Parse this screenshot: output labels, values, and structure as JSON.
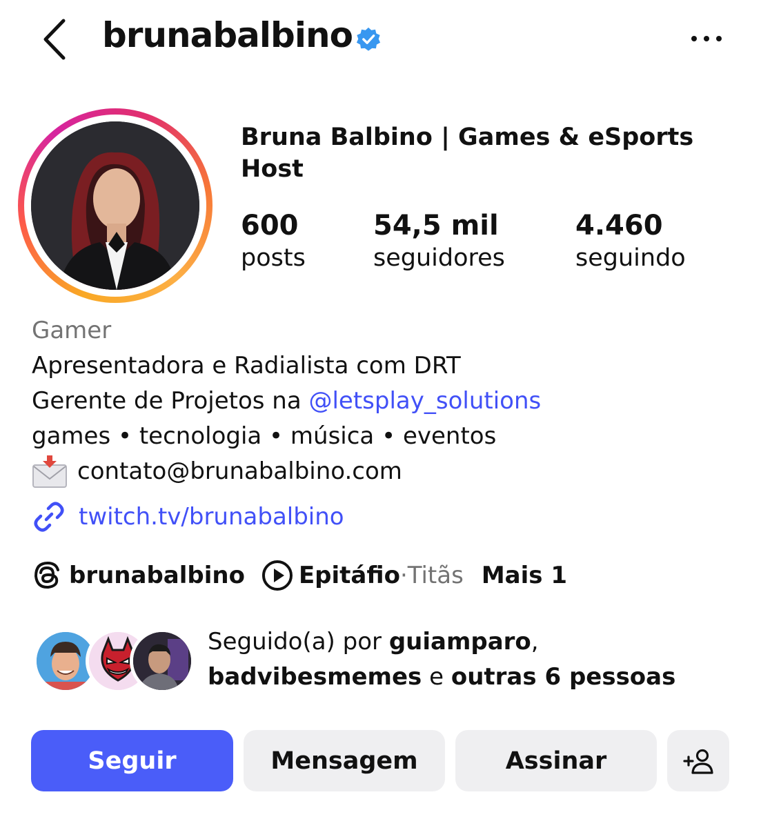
{
  "header": {
    "username": "brunabalbino",
    "back_icon": "chevron-left-icon",
    "verified_icon": "verified-badge-icon",
    "more_icon": "ellipsis-icon"
  },
  "profile": {
    "full_name": "Bruna Balbino | Games & eSports Host",
    "stats": [
      {
        "value": "600",
        "label": "posts"
      },
      {
        "value": "54,5 mil",
        "label": "seguidores"
      },
      {
        "value": "4.460",
        "label": "seguindo"
      }
    ]
  },
  "bio": {
    "category": "Gamer",
    "line1": "Apresentadora e Radialista com DRT",
    "line2_prefix": "Gerente de Projetos na ",
    "line2_mention": "@letsplay_solutions",
    "line3": "games • tecnologia • música • eventos",
    "email_icon": "envelope-icon",
    "email": "contato@brunabalbino.com",
    "link_icon": "link-icon",
    "link": "twitch.tv/brunabalbino"
  },
  "meta": {
    "threads_icon": "threads-icon",
    "threads_handle": "brunabalbino",
    "music_icon": "play-circle-icon",
    "song": "Epitáfio",
    "separator": " · ",
    "artist": "Titãs",
    "more": "Mais 1"
  },
  "followed_by": {
    "prefix": "Seguido(a) por ",
    "user1": "guiamparo",
    "comma": ",",
    "user2": "badvibesmemes",
    "conj": " e ",
    "others": "outras 6 pessoas"
  },
  "actions": {
    "follow": "Seguir",
    "message": "Mensagem",
    "subscribe": "Assinar",
    "suggest_icon": "add-person-icon"
  },
  "colors": {
    "primary_button": "#4a5df9",
    "link": "#4150f7",
    "verified": "#3897f0",
    "secondary_button": "#efeff1"
  }
}
